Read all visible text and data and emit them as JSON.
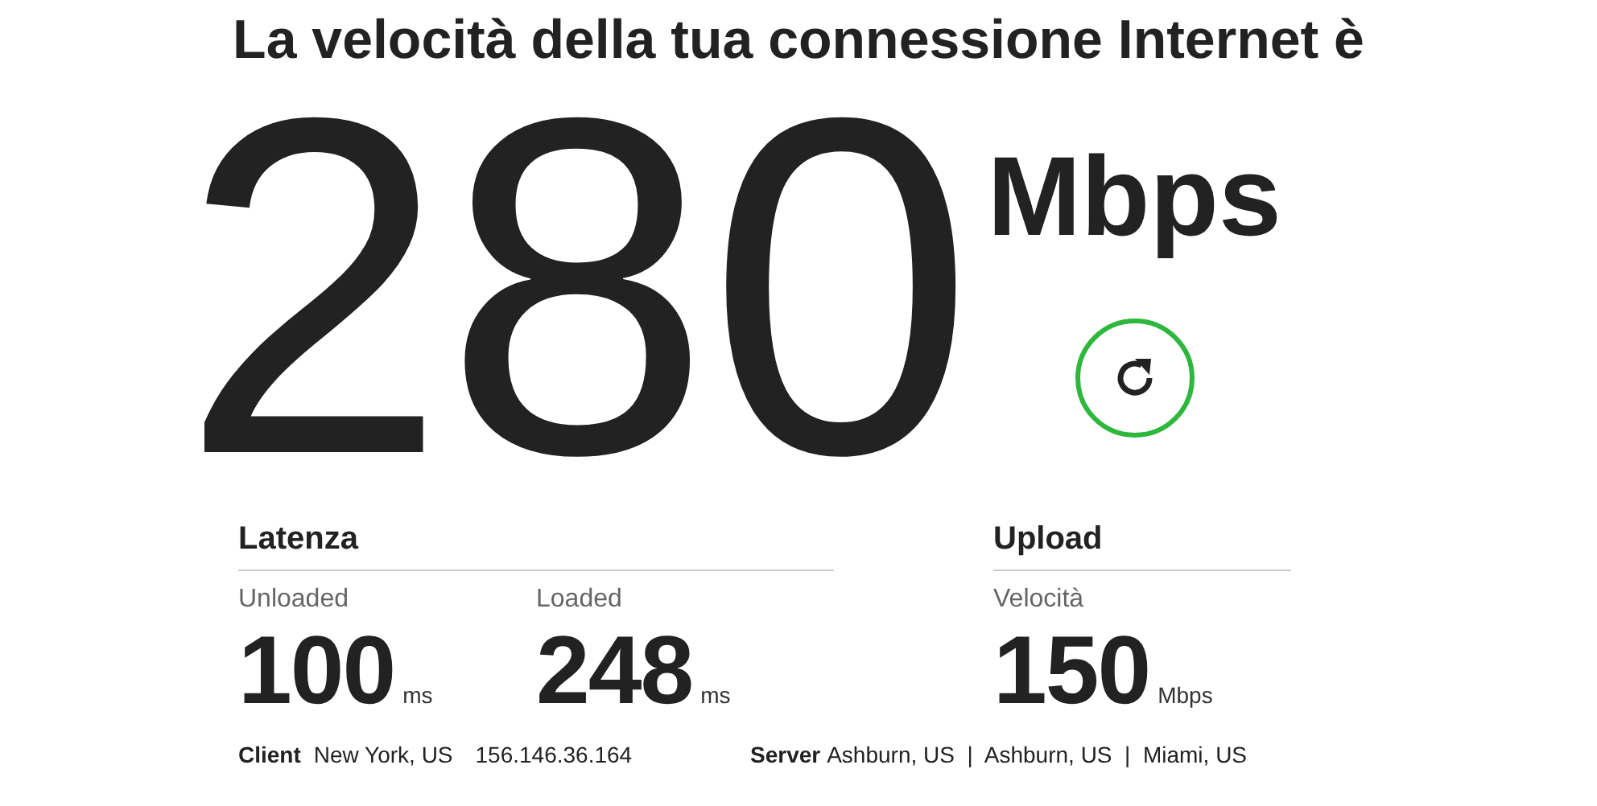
{
  "headline": "La velocità della tua connessione Internet è",
  "speed": {
    "value": "280",
    "unit": "Mbps"
  },
  "latency": {
    "title": "Latenza",
    "metrics": [
      {
        "label": "Unloaded",
        "value": "100",
        "unit": "ms"
      },
      {
        "label": "Loaded",
        "value": "248",
        "unit": "ms"
      }
    ]
  },
  "upload": {
    "title": "Upload",
    "metrics": [
      {
        "label": "Velocità",
        "value": "150",
        "unit": "Mbps"
      }
    ]
  },
  "footer": {
    "client_label": "Client",
    "client_location": "New York, US",
    "client_ip": "156.146.36.164",
    "server_label": "Server",
    "server_value": "Ashburn, US  |  Ashburn, US  |  Miami, US"
  }
}
